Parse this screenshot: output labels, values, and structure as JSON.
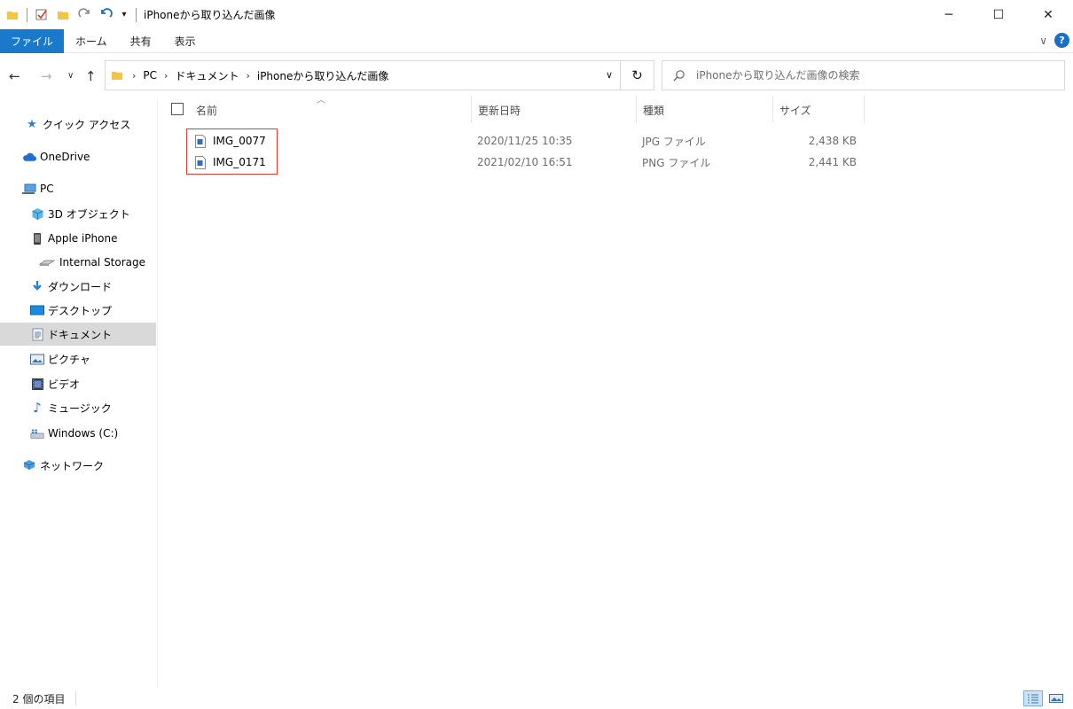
{
  "window": {
    "title": "iPhoneから取り込んだ画像",
    "minimize": "─",
    "maximize": "☐",
    "close": "✕"
  },
  "ribbon": {
    "tabs": [
      "ファイル",
      "ホーム",
      "共有",
      "表示"
    ],
    "expand": "∨",
    "help": "?"
  },
  "address": {
    "crumbs": [
      "PC",
      "ドキュメント",
      "iPhoneから取り込んだ画像"
    ],
    "separator": "›",
    "dropdown": "∨",
    "refresh": "↻"
  },
  "search": {
    "placeholder": "iPhoneから取り込んだ画像の検索"
  },
  "nav": {
    "back": "←",
    "forward": "→",
    "recent": "∨",
    "up": "↑",
    "items": [
      {
        "label": "クイック アクセス",
        "icon": "star-icon"
      },
      {
        "label": "OneDrive",
        "icon": "cloud-icon"
      },
      {
        "label": "PC",
        "icon": "computer-icon"
      },
      {
        "label": "3D オブジェクト",
        "icon": "cube-icon"
      },
      {
        "label": "Apple iPhone",
        "icon": "phone-icon"
      },
      {
        "label": "Internal Storage",
        "icon": "drive-icon"
      },
      {
        "label": "ダウンロード",
        "icon": "download-icon"
      },
      {
        "label": "デスクトップ",
        "icon": "desktop-icon"
      },
      {
        "label": "ドキュメント",
        "icon": "document-icon"
      },
      {
        "label": "ピクチャ",
        "icon": "picture-icon"
      },
      {
        "label": "ビデオ",
        "icon": "video-icon"
      },
      {
        "label": "ミュージック",
        "icon": "music-icon"
      },
      {
        "label": "Windows (C:)",
        "icon": "windows-drive-icon"
      },
      {
        "label": "ネットワーク",
        "icon": "network-icon"
      }
    ]
  },
  "columns": {
    "name": "名前",
    "date": "更新日時",
    "type": "種類",
    "size": "サイズ"
  },
  "files": [
    {
      "name": "IMG_0077",
      "date": "2020/11/25 10:35",
      "type": "JPG ファイル",
      "size": "2,438 KB"
    },
    {
      "name": "IMG_0171",
      "date": "2021/02/10 16:51",
      "type": "PNG ファイル",
      "size": "2,441 KB"
    }
  ],
  "status": {
    "count": "2 個の項目"
  },
  "colors": {
    "accent": "#1979ca",
    "highlight": "#e03c31",
    "folder": "#f4c542"
  }
}
